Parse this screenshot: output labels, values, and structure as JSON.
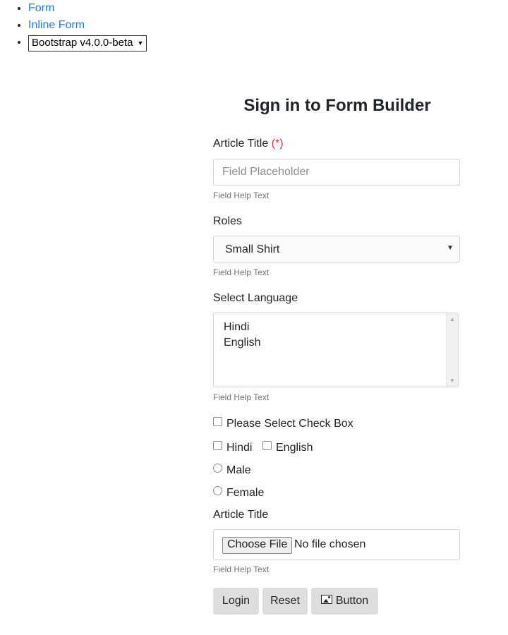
{
  "nav": {
    "form_link": "Form",
    "inline_form_link": "Inline Form",
    "version_select": "Bootstrap v4.0.0-beta"
  },
  "form": {
    "title": "Sign in to Form Builder",
    "article_title_label": "Article Title",
    "required_mark": "(*)",
    "field_placeholder": "Field Placeholder",
    "help_text": "Field Help Text",
    "roles_label": "Roles",
    "roles_selected": "Small Shirt",
    "language_label": "Select Language",
    "language_options": [
      "Hindi",
      "English"
    ],
    "checkbox_single": "Please Select Check Box",
    "checkbox_hindi": "Hindi",
    "checkbox_english": "English",
    "radio_male": "Male",
    "radio_female": "Female",
    "file_label": "Article Title",
    "file_button": "Choose File",
    "file_status": "No file chosen",
    "login_button": "Login",
    "reset_button": "Reset",
    "generic_button": "Button"
  },
  "colors": {
    "link": "#1f7ad6",
    "required": "#dc3545",
    "button_bg": "#dedede"
  },
  "icons": {
    "image_icon": "image-icon",
    "select_caret": "chevron-down-icon"
  }
}
